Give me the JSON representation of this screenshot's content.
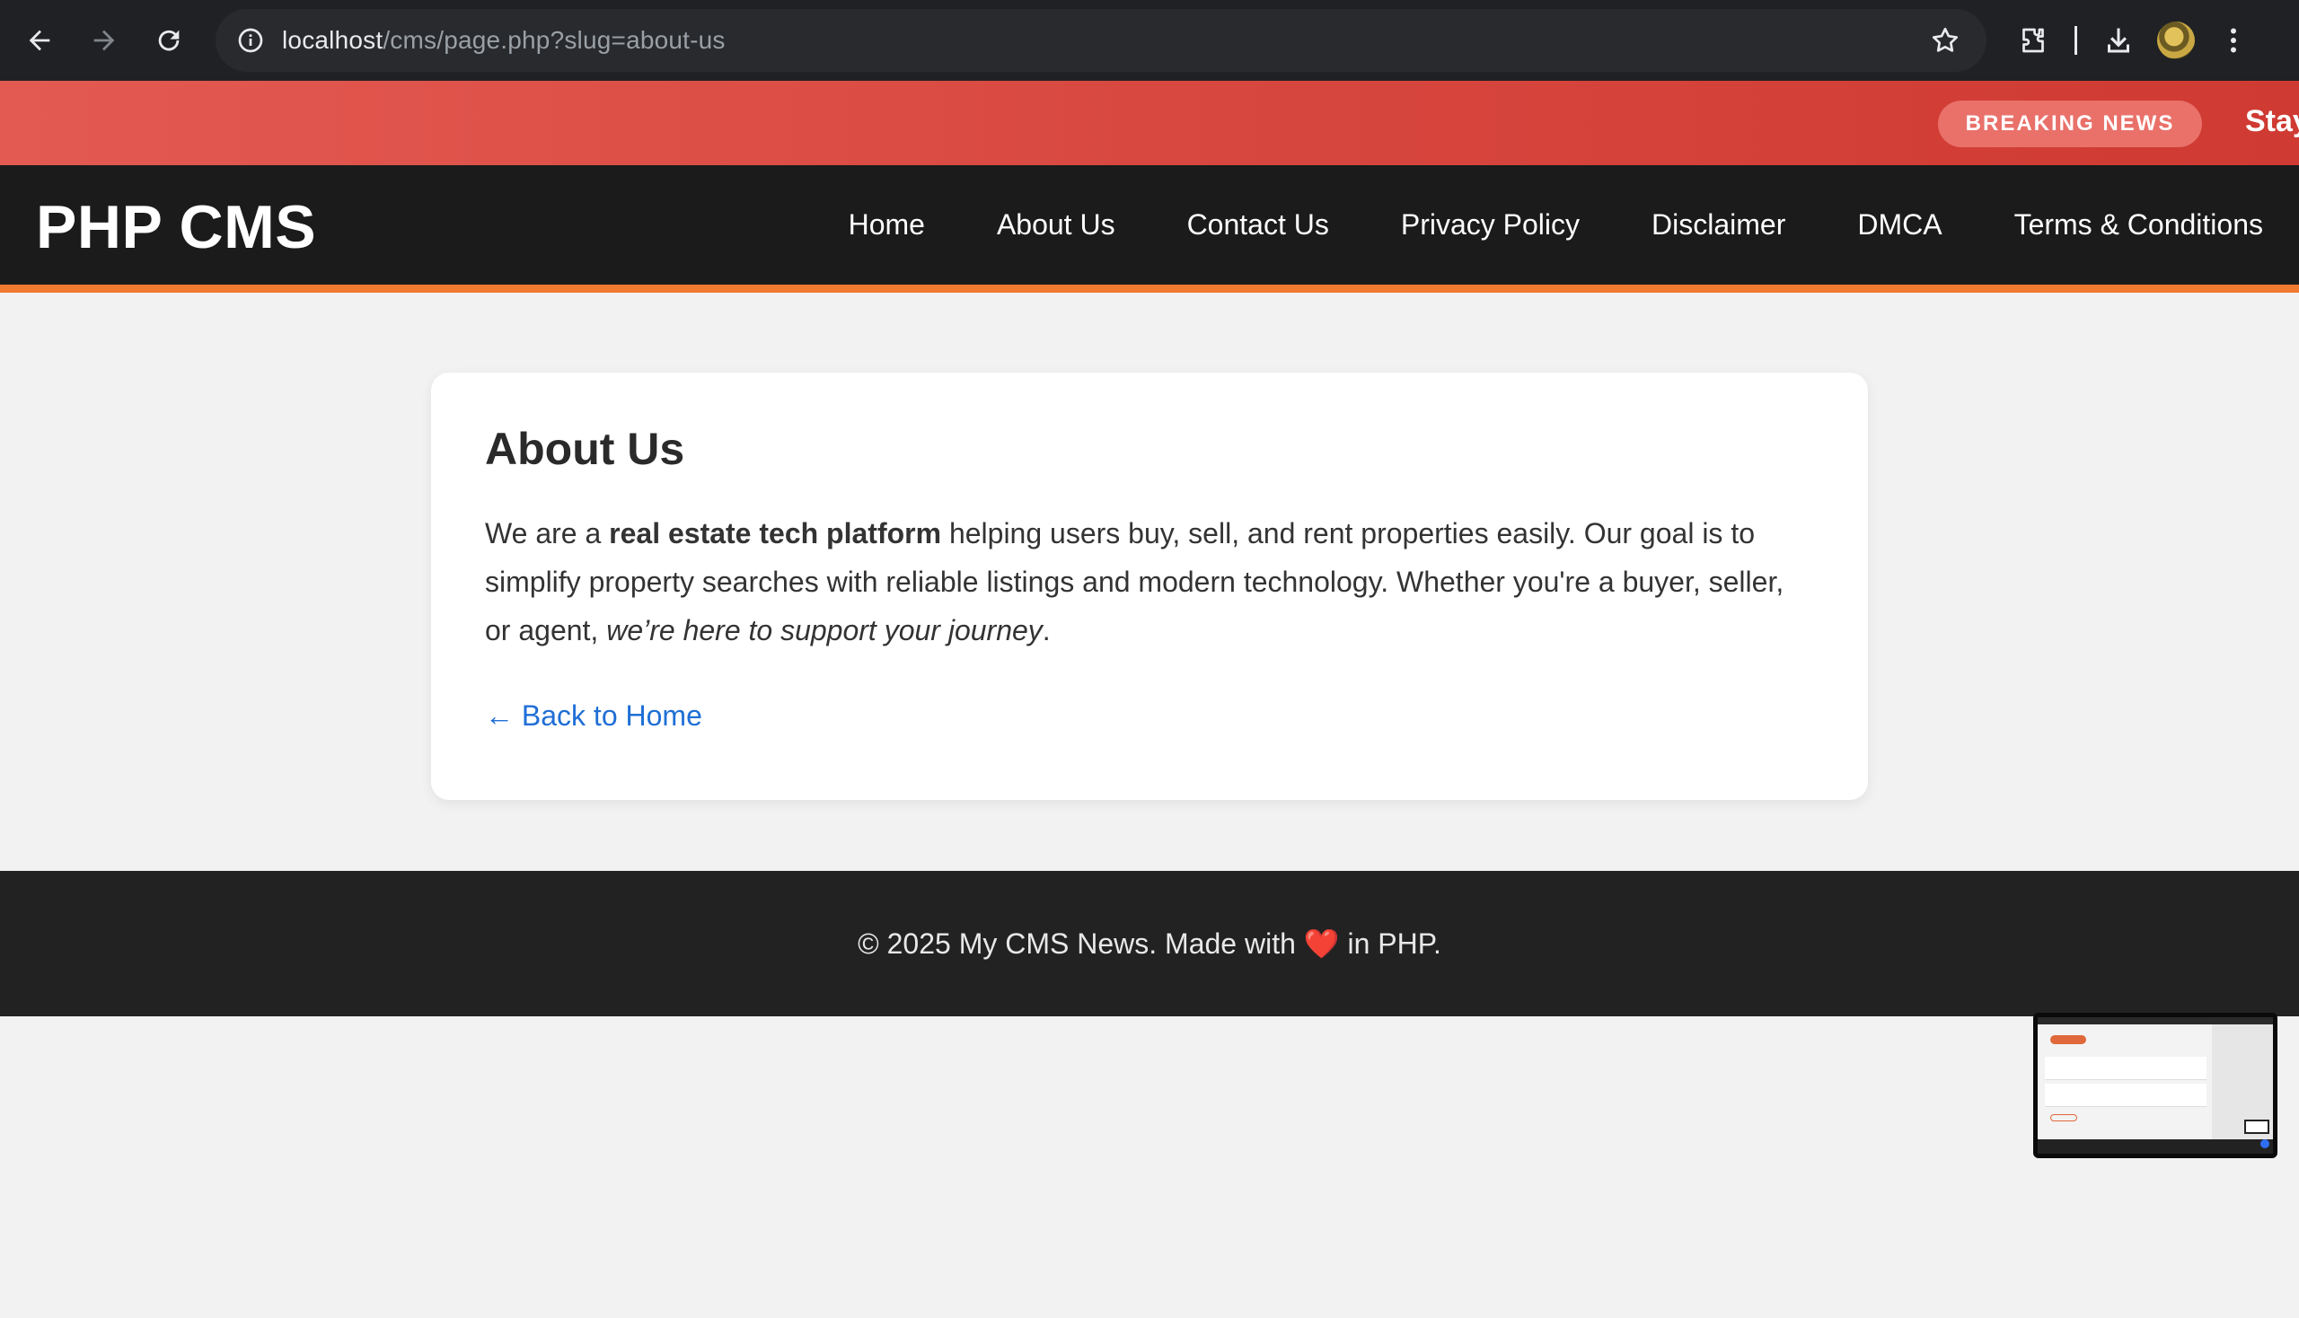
{
  "browser": {
    "url_host": "localhost",
    "url_path": "/cms/page.php?slug=about-us",
    "icons": [
      "back-icon",
      "forward-icon",
      "reload-icon",
      "site-info-icon",
      "bookmark-star-icon",
      "extensions-icon",
      "download-icon",
      "profile-avatar",
      "more-menu-icon"
    ]
  },
  "breaking": {
    "badge": "BREAKING NEWS",
    "ticker": "Stay"
  },
  "site": {
    "logo": "PHP CMS",
    "nav": [
      "Home",
      "About Us",
      "Contact Us",
      "Privacy Policy",
      "Disclaimer",
      "DMCA",
      "Terms & Conditions"
    ]
  },
  "page": {
    "title": "About Us",
    "body": {
      "t1": "We are a ",
      "bold": "real estate tech platform",
      "t2": " helping users buy, sell, and rent properties easily. Our goal is to simplify property searches with reliable listings and modern technology. Whether you're a buyer, seller, or agent, ",
      "italic": "we’re here to support your journey",
      "t3": "."
    },
    "back_link": "← Back to Home"
  },
  "footer": {
    "before": "© 2025 My CMS News. Made with ",
    "heart": "❤️",
    "after": " in PHP."
  },
  "colors": {
    "breaking_bar": "#d84840",
    "header_bg": "#1b1b1b",
    "header_accent": "#f07a2f",
    "link": "#1f6fd6",
    "footer_bg": "#222222"
  }
}
